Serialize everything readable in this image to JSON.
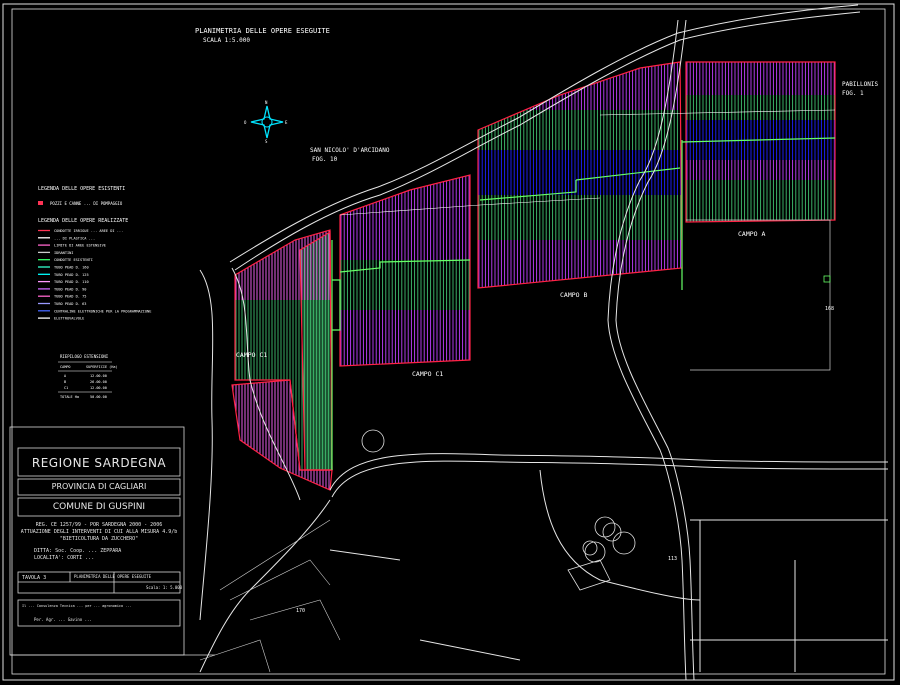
{
  "header": {
    "title": "PLANIMETRIA DELLE OPERE ESEGUITE",
    "scale": "SCALA 1:5.000"
  },
  "compass_labels": [
    "N",
    "S",
    "E",
    "O"
  ],
  "place_labels": {
    "san_nicolo": "SAN NICOLO' D'ARCIDANO",
    "san_nicolo_fog": "FOG. 10",
    "pabillonis": "PABILLONIS",
    "pabillonis_fog": "FOG. 1"
  },
  "field_labels": {
    "campo_a": "CAMPO A",
    "campo_b": "CAMPO B",
    "campo_c1_mid": "CAMPO C1",
    "campo_c1_left": "CAMPO C1"
  },
  "legend": {
    "existing_title": "LEGENDA DELLE OPERE ESISTENTI",
    "existing_item": "POZZI E CANNE ... DI POMPAGGIO",
    "realized_title": "LEGENDA DELLE OPERE REALIZZATE",
    "items": [
      {
        "label": "CONDOTTE IRRIGUE ... AREE DI ...",
        "color": "#ff3355"
      },
      {
        "label": "... DI PLASTICA ...",
        "color": "#ffffff"
      },
      {
        "label": "LIMITE DI AREE ESTENSIVE",
        "color": "#ff66cc"
      },
      {
        "label": "IDRANTINI",
        "color": "#cccccc"
      },
      {
        "label": "CONDOTTE ESISTENTI",
        "color": "#33ff66"
      },
      {
        "label": "TUBO PEAD D. 160",
        "color": "#33ffcc"
      },
      {
        "label": "TUBO PEAD D. 125",
        "color": "#00ffff"
      },
      {
        "label": "TUBO PEAD D. 110",
        "color": "#ff99ff"
      },
      {
        "label": "TUBO PEAD D. 90",
        "color": "#cc66ff"
      },
      {
        "label": "TUBO PEAD D. 75",
        "color": "#ff66cc"
      },
      {
        "label": "TUBO PEAD D. 63",
        "color": "#9999ff"
      },
      {
        "label": "CENTRALINE ELETTRONICHE PER LA PROGRAMMAZIONE",
        "color": "#4466ff"
      },
      {
        "label": "ELETTROVALVOLE",
        "color": "#ffffff"
      }
    ]
  },
  "summary_table": {
    "title": "RIEPILOGO ESTENSIONI",
    "headers": [
      "CAMPO",
      "SUPERFICIE (Ha)"
    ],
    "rows": [
      [
        "A",
        "12.00.00"
      ],
      [
        "B",
        "26.00.00"
      ],
      [
        "C1",
        "12.00.00"
      ]
    ],
    "total_label": "TOTALE Ha",
    "total_value": "50.00.00"
  },
  "title_block": {
    "region": "REGIONE SARDEGNA",
    "province": "PROVINCIA DI CAGLIARI",
    "commune": "COMUNE DI GUSPINI",
    "project_line1": "REG. CE 1257/99 - POR SARDEGNA 2000 - 2006",
    "project_line2": "ATTUAZIONE DEGLI INTERVENTI DI CUI ALLA MISURA 4.9/b",
    "project_line3": "\"BIETICOLTURA DA ZUCCHERO\"",
    "ditta": "DITTA: Soc. Coop. ... ZEPPARA",
    "localita": "LOCALITA': CORTI ... ",
    "tavola": "TAVOLA 3",
    "tavola_title": "PLANIMETRIA DELLE OPERE ESEGUITE",
    "scala": "Scala: 1: 5.000",
    "signature_line": "Il ... Consulenza Tecnica ... per ... agronomico ...",
    "engineer": "Per. Agr. ... Gavino ..."
  },
  "road_labels": [
    "168",
    "170",
    "113"
  ],
  "colors": {
    "background": "#000000",
    "field_border": "#ff2244",
    "pipe_magenta": "#ff66ff",
    "pipe_purple": "#c040ff",
    "pipe_green": "#40c070",
    "pipe_cyan": "#20a0a0",
    "pipe_blue": "#2020ff",
    "mains": "#66ff66",
    "road": "#ffffff",
    "compass": "#00e5ff"
  }
}
